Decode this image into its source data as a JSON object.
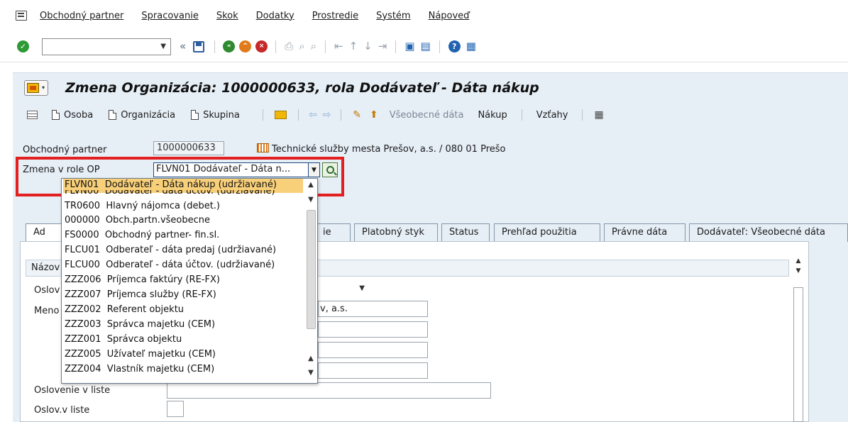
{
  "menu": {
    "items": [
      "Obchodný partner",
      "Spracovanie",
      "Skok",
      "Dodatky",
      "Prostredie",
      "Systém",
      "Nápoveď"
    ]
  },
  "title": "Zmena Organizácia: 1000000633, rola Dodávateľ - Dáta nákup",
  "app_toolbar": {
    "osoba": "Osoba",
    "organizacia": "Organizácia",
    "skupina": "Skupina",
    "vseobecne_data": "Všeobecné dáta",
    "nakup": "Nákup",
    "vztahy": "Vzťahy"
  },
  "header": {
    "partner_label": "Obchodný partner",
    "partner_number": "1000000633",
    "partner_name": "Technické služby mesta Prešov, a.s. / 080 01 Prešo",
    "role_label": "Zmena v role OP",
    "role_value": "FLVN01 Dodávateľ - Dáta n..."
  },
  "dropdown": {
    "items": [
      {
        "code": "FLVN01",
        "text": "Dodávateľ - Dáta nákup (udržiavané)"
      },
      {
        "code": "FLVN00",
        "text": "Dodávateľ - dáta účtov. (udržiavané)"
      },
      {
        "code": "TR0600",
        "text": "Hlavný nájomca (debet.)"
      },
      {
        "code": "000000",
        "text": "Obch.partn.všeobecne"
      },
      {
        "code": "FS0000",
        "text": "Obchodný partner- fin.sl."
      },
      {
        "code": "FLCU01",
        "text": "Odberateľ - dáta predaj (udržiavané)"
      },
      {
        "code": "FLCU00",
        "text": "Odberateľ - dáta účtov. (udržiavané)"
      },
      {
        "code": "ZZZ006",
        "text": "Príjemca faktúry (RE-FX)"
      },
      {
        "code": "ZZZ007",
        "text": "Príjemca služby (RE-FX)"
      },
      {
        "code": "ZZZ002",
        "text": "Referent objektu"
      },
      {
        "code": "ZZZ003",
        "text": "Správca majetku (CEM)"
      },
      {
        "code": "ZZZ001",
        "text": "Správca objektu"
      },
      {
        "code": "ZZZ005",
        "text": "Užívateľ majetku (CEM)"
      },
      {
        "code": "ZZZ004",
        "text": "Vlastník majetku (CEM)"
      }
    ]
  },
  "tabs": {
    "t0": "Ad",
    "t1": "ie",
    "t2": "Platobný styk",
    "t3": "Status",
    "t4": "Prehľad použitia",
    "t5": "Právne dáta",
    "t6": "Dodávateľ: Všeobecné dáta"
  },
  "form": {
    "group_label_cut": "Názov",
    "oslov_cut": "Oslov",
    "meno_cut": "Meno",
    "name_value_cut": "v, a.s.",
    "oslovenie_v_liste": "Oslovenie v liste",
    "oslov_v_liste": "Oslov.v liste"
  },
  "colors": {
    "highlight": "#e32020",
    "selected_item": "#f8d07a",
    "panel": "#e6eef6"
  }
}
